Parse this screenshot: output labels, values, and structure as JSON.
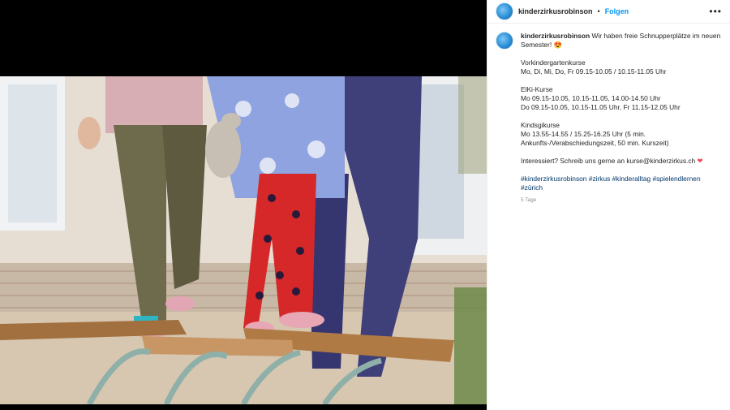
{
  "header": {
    "username": "kinderzirkusrobinson",
    "separator": "•",
    "follow_label": "Folgen",
    "more_label": "•••"
  },
  "post": {
    "intro": "Wir haben freie Schnupperplätze im neuen Semester! 😍",
    "sections": [
      {
        "title": "Vorkindergartenkurse",
        "lines": [
          "Mo, Di, Mi, Do, Fr 09.15-10.05 / 10.15-11.05 Uhr"
        ]
      },
      {
        "title": "ElKi-Kurse",
        "lines": [
          "Mo 09.15-10.05, 10.15-11.05, 14.00-14.50 Uhr",
          "Do 09.15-10.05, 10.15-11.05 Uhr, Fr 11.15-12.05 Uhr"
        ]
      },
      {
        "title": "Kindsgikurse",
        "lines": [
          "Mo 13.55-14.55 / 15.25-16.25 Uhr (5 min. Ankunfts-/Verabschiedungszeit, 50 min. Kurszeit)"
        ]
      }
    ],
    "cta": "Interessiert? Schreib uns gerne an kurse@kinderzirkus.ch",
    "cta_emoji": "❤",
    "hashtags": "#kinderzirkusrobinson #zirkus #kinderalltag #spielendlernen #zürich",
    "time": "5 Tage"
  },
  "colors": {
    "accent": "#0095f6",
    "hashtag": "#00376b",
    "heart": "#ed4956"
  }
}
